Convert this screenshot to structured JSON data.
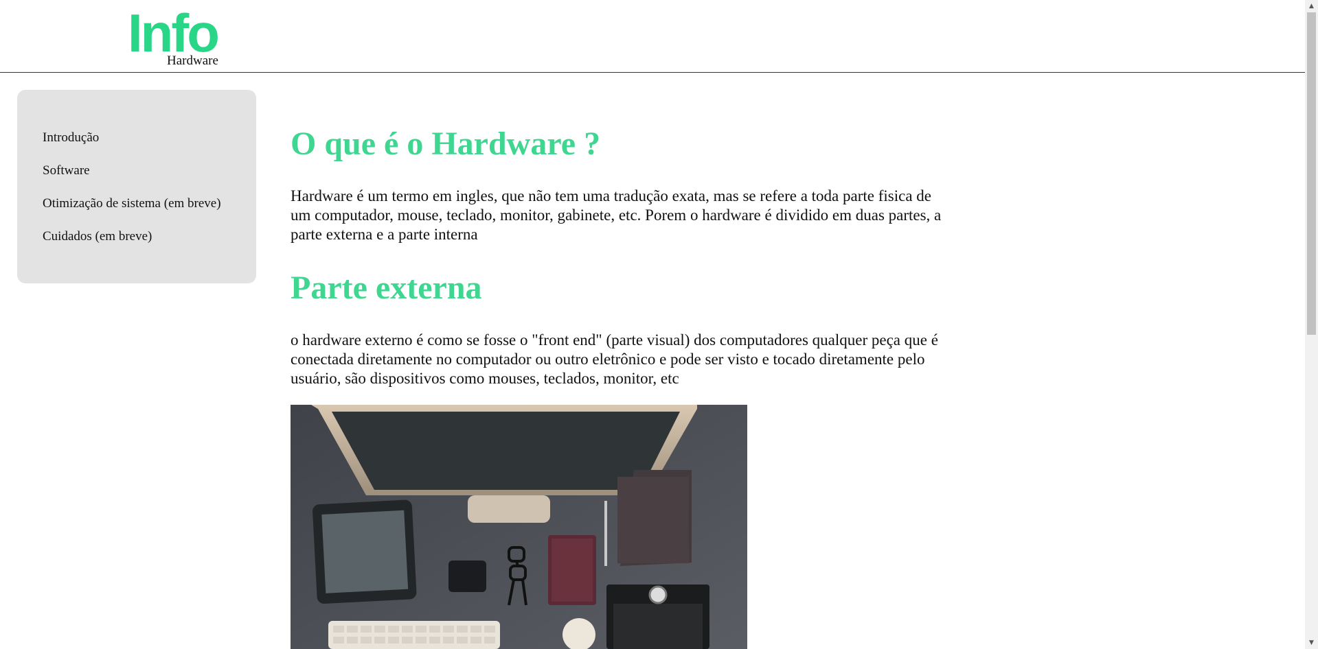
{
  "header": {
    "logo_title": "Info",
    "logo_subtitle": "Hardware"
  },
  "sidebar": {
    "items": [
      {
        "label": "Introdução"
      },
      {
        "label": "Software"
      },
      {
        "label": "Otimização de sistema (em breve)"
      },
      {
        "label": "Cuidados (em breve)"
      }
    ]
  },
  "main": {
    "heading_1": "O que é o Hardware ?",
    "paragraph_1": "Hardware é um termo em ingles, que não tem uma tradução exata, mas se refere a toda parte fisica de um computador, mouse, teclado, monitor, gabinete, etc. Porem o hardware é dividido em duas partes, a parte externa e a parte interna",
    "heading_2": "Parte externa",
    "paragraph_2": "o hardware externo é como se fosse o \"front end\" (parte visual) dos computadores qualquer peça que é conectada diretamente no computador ou outro eletrônico e pode ser visto e tocado diretamente pelo usuário, são dispositivos como mouses, teclados, monitor, etc"
  },
  "colors": {
    "accent": "#3ed690",
    "logo": "#29d688",
    "sidebar_bg": "#e3e3e3"
  },
  "icons": {
    "scroll_up": "scroll-up-arrow-icon",
    "scroll_down": "scroll-down-arrow-icon"
  }
}
